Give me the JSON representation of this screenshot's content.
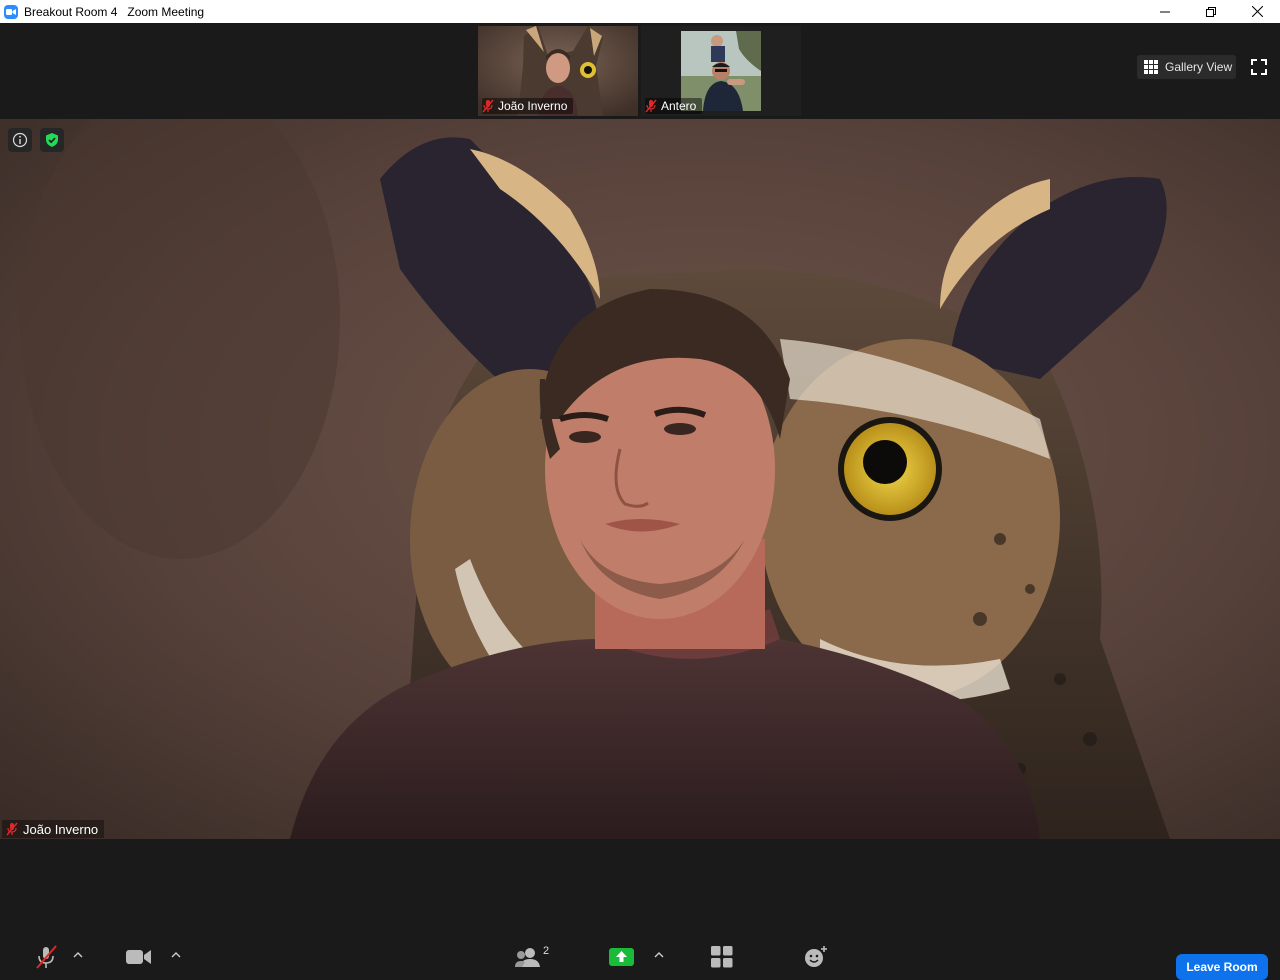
{
  "window": {
    "title": "Breakout Room 4   Zoom Meeting",
    "controls": [
      "minimize",
      "restore",
      "close"
    ]
  },
  "thumbnails": [
    {
      "name": "João Inverno",
      "muted": true,
      "icon": "mic-off-icon"
    },
    {
      "name": "Antero",
      "muted": true,
      "icon": "mic-off-icon"
    }
  ],
  "view_toggle": {
    "label": "Gallery View",
    "icon": "grid-icon"
  },
  "main_video": {
    "speaker_name": "João Inverno",
    "muted": true,
    "background": "owl virtual background"
  },
  "toolbar": {
    "participants_count": "2",
    "leave_label": "Leave Room"
  },
  "colors": {
    "accent": "#0e72ed",
    "share_green": "#1bbb3a",
    "muted_red": "#e02828",
    "shield_green": "#23d959"
  }
}
